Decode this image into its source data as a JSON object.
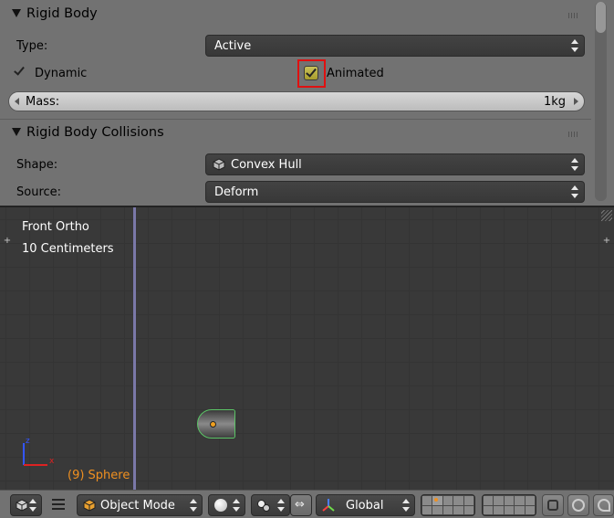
{
  "rigid_body": {
    "title": "Rigid Body",
    "type_label": "Type:",
    "type_value": "Active",
    "dynamic_label": "Dynamic",
    "animated_label": "Animated",
    "mass_label": "Mass:",
    "mass_value": "1kg"
  },
  "rigid_body_collisions": {
    "title": "Rigid Body Collisions",
    "shape_label": "Shape:",
    "shape_value": "Convex Hull",
    "source_label": "Source:",
    "source_value": "Deform"
  },
  "viewport": {
    "view_name": "Front Ortho",
    "grid_scale": "10 Centimeters",
    "object_name": "(9) Sphere",
    "axis_z": "z",
    "axis_x": "x"
  },
  "header": {
    "mode_value": "Object Mode",
    "orientation_value": "Global"
  },
  "colors": {
    "panel_bg": "#727272",
    "viewport_bg": "#393939",
    "highlight_box": "#e01010",
    "selected_outline": "#5bc466",
    "object_label": "#f09020"
  }
}
